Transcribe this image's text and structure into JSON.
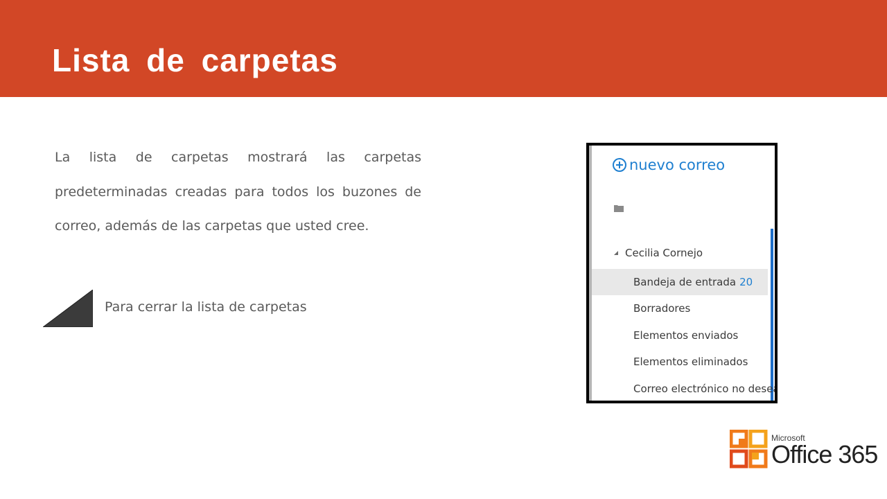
{
  "slide": {
    "title": "Lista  de  carpetas",
    "body": "La lista de carpetas mostrará las carpetas predeterminadas creadas para todos los buzones de correo, además de las carpetas que usted cree.",
    "caption": "Para cerrar la lista de carpetas",
    "colors": {
      "accent": "#d24726",
      "text": "#5a5a5a",
      "link": "#1e7fd0"
    },
    "icon": "triangle-corner-icon"
  },
  "screenshot": {
    "new_mail_label": "nuevo correo",
    "folder_icon": "folder-icon",
    "account_name": "Cecilia Cornejo",
    "folders": [
      {
        "label": "Bandeja de entrada",
        "count": "20",
        "selected": true
      },
      {
        "label": "Borradores",
        "count": ""
      },
      {
        "label": "Elementos enviados",
        "count": ""
      },
      {
        "label": "Elementos eliminados",
        "count": ""
      },
      {
        "label": "Correo electrónico no deseado",
        "count": ""
      }
    ]
  },
  "logo": {
    "microsoft": "Microsoft",
    "product": "Office 365"
  }
}
